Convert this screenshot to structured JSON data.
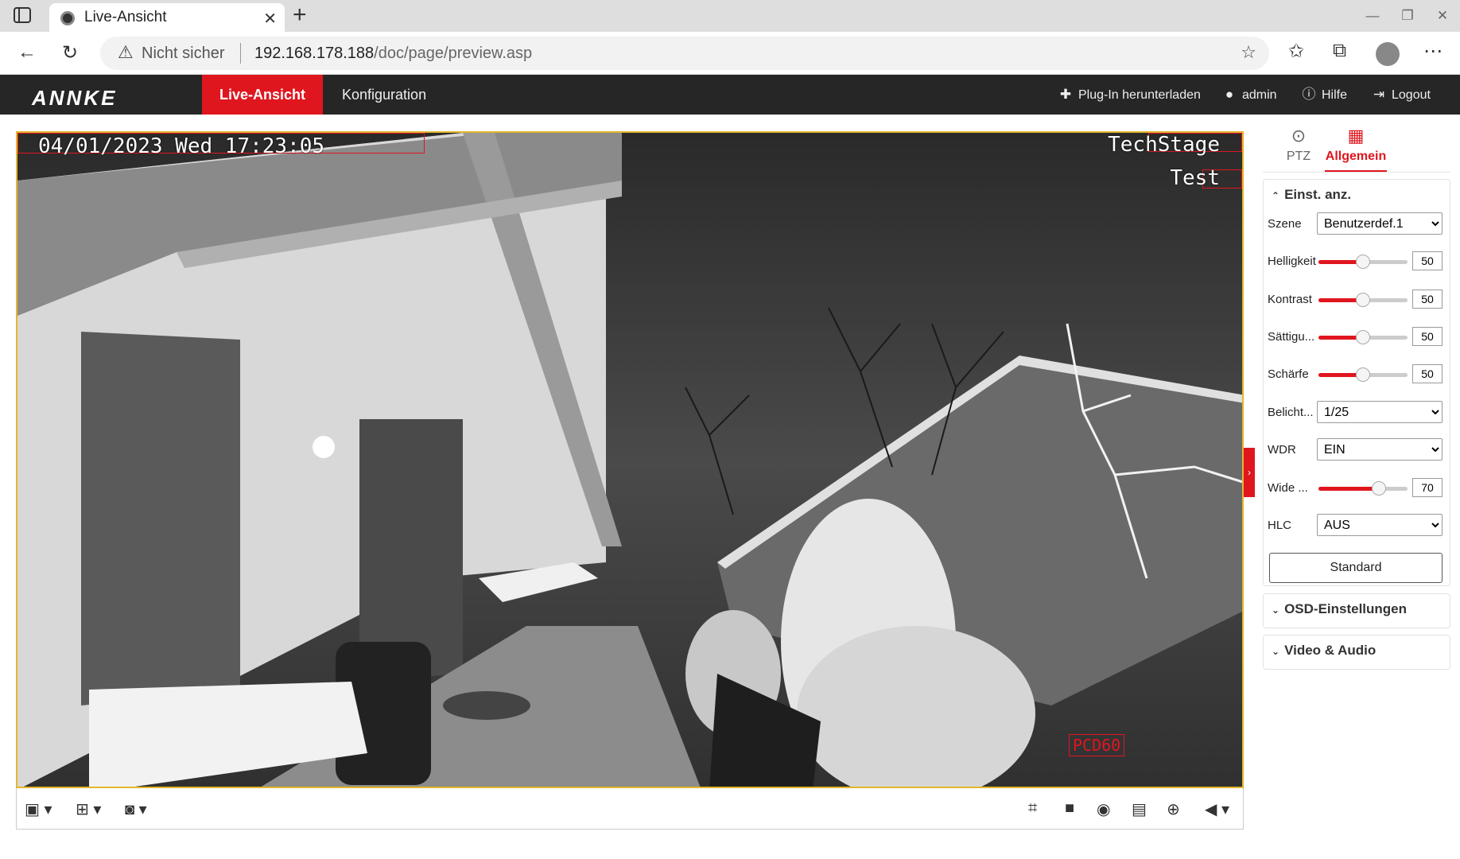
{
  "browser": {
    "tab_title": "Live-Ansicht",
    "not_secure": "Nicht sicher",
    "url_host": "192.168.178.188",
    "url_path": "/doc/page/preview.asp"
  },
  "app": {
    "logo": "ANNKE",
    "nav": {
      "live": "Live-Ansicht",
      "config": "Konfiguration"
    },
    "header_right": {
      "plugin": "Plug-In herunterladen",
      "user": "admin",
      "help": "Hilfe",
      "logout": "Logout"
    }
  },
  "video": {
    "osd_datetime": "04/01/2023 Wed 17:23:05",
    "osd_top_right": "TechStage",
    "osd_test": "Test",
    "osd_pcd": "PCD60"
  },
  "panel": {
    "tabs": {
      "ptz": "PTZ",
      "general": "Allgemein"
    },
    "section_display": "Einst. anz.",
    "scene_label": "Szene",
    "scene_value": "Benutzerdef.1",
    "brightness_label": "Helligkeit",
    "brightness_value": "50",
    "contrast_label": "Kontrast",
    "contrast_value": "50",
    "saturation_label": "Sättigu...",
    "saturation_value": "50",
    "sharpness_label": "Schärfe",
    "sharpness_value": "50",
    "exposure_label": "Belicht...",
    "exposure_value": "1/25",
    "wdr_label": "WDR",
    "wdr_value": "EIN",
    "wide_label": "Wide ...",
    "wide_value": "70",
    "hlc_label": "HLC",
    "hlc_value": "AUS",
    "standard_button": "Standard",
    "section_osd": "OSD-Einstellungen",
    "section_video_audio": "Video & Audio"
  },
  "colors": {
    "accent": "#e0161f",
    "header_bg": "#262626",
    "video_border": "#e3b62d"
  }
}
